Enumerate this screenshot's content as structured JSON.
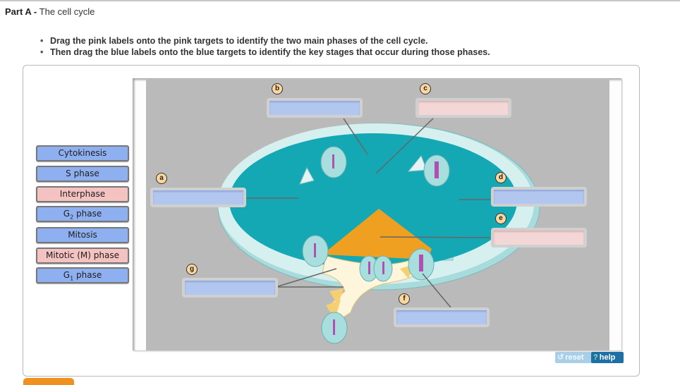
{
  "part": {
    "prefix": "Part A -",
    "title": "The cell cycle"
  },
  "instructions": [
    "Drag the pink labels onto the pink targets to identify the two main phases of the cell cycle.",
    "Then drag the blue labels onto the blue targets to identify the key stages that occur during those phases."
  ],
  "labels": [
    {
      "text": "Cytokinesis",
      "color": "blue"
    },
    {
      "text": "S phase",
      "color": "blue"
    },
    {
      "text": "Interphase",
      "color": "pink"
    },
    {
      "text_main": "G",
      "text_sub": "2",
      "text_rest": " phase",
      "color": "blue"
    },
    {
      "text": "Mitosis",
      "color": "blue"
    },
    {
      "text": "Mitotic (M) phase",
      "color": "pink"
    },
    {
      "text_main": "G",
      "text_sub": "1",
      "text_rest": " phase",
      "color": "blue"
    }
  ],
  "targets": {
    "a": {
      "letter": "a",
      "color": "blue"
    },
    "b": {
      "letter": "b",
      "color": "blue"
    },
    "c": {
      "letter": "c",
      "color": "pink"
    },
    "d": {
      "letter": "d",
      "color": "blue"
    },
    "e": {
      "letter": "e",
      "color": "pink"
    },
    "f": {
      "letter": "f",
      "color": "blue"
    },
    "g": {
      "letter": "g",
      "color": "blue"
    }
  },
  "controls": {
    "reset_icon": "↺",
    "reset_label": "reset",
    "help_icon": "?",
    "help_label": "help"
  },
  "colors": {
    "blue_label": "#8fb0f0",
    "pink_label": "#f4c2c0",
    "teal": "#14a8b4",
    "orange": "#f0a020",
    "help_button": "#1d6fa5"
  }
}
